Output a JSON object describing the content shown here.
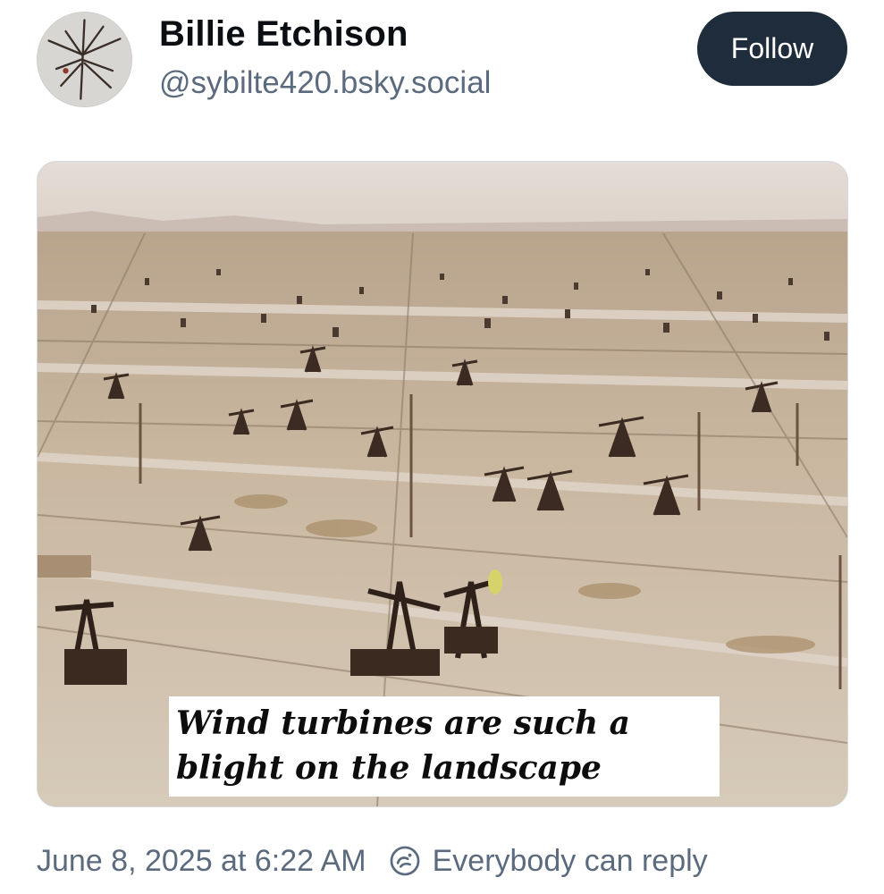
{
  "post": {
    "author": {
      "display_name": "Billie Etchison",
      "handle": "@sybilte420.bsky.social"
    },
    "follow_label": "Follow",
    "image": {
      "caption_line1": "Wind turbines are such a",
      "caption_line2": "blight on the landscape"
    },
    "timestamp": "June 8, 2025 at 6:22 AM",
    "reply_setting": "Everybody can reply"
  },
  "icons": {
    "avatar": "avatar-image",
    "reply": "reply-setting-icon"
  },
  "colors": {
    "follow_button": "#1f2c3b",
    "secondary_text": "#5b6b7d",
    "primary_text": "#0b0f14"
  }
}
